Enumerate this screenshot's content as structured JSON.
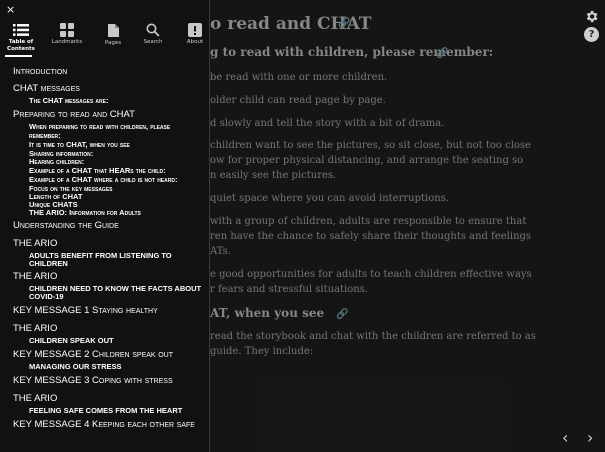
{
  "reader": {
    "heading_main": "o read and CHAT",
    "heading_sub": "g to read with children, please remember:",
    "paragraphs": [
      "be read with one or more children.",
      "older child can read page by page.",
      "d slowly and tell the story with a bit of drama.",
      "children want to see the pictures, so sit close, but not too close",
      "ow for proper physical distancing, and arrange the seating so",
      "n easily see the pictures.",
      "quiet space where you can avoid interruptions.",
      "with a group of children, adults are responsible to ensure that",
      "ren have the chance to safely share their thoughts and feelings",
      "ATs.",
      "e good opportunities for adults to teach children effective ways",
      "r fears and stressful situations."
    ],
    "heading_chat": "AT, when you see",
    "paragraphs2": [
      "read the storybook and chat with the children are referred to as",
      "guide. They include:"
    ],
    "help_label": "?"
  },
  "sidebar": {
    "close_label": "×",
    "tabs": [
      {
        "label": "Table of Contents",
        "icon": "list-icon"
      },
      {
        "label": "Landmarks",
        "icon": "grid-icon"
      },
      {
        "label": "Pages",
        "icon": "pages-icon"
      },
      {
        "label": "Search",
        "icon": "search-icon"
      },
      {
        "label": "About",
        "icon": "info-icon"
      }
    ],
    "toc": [
      {
        "label": "Introduction",
        "level": 1
      },
      {
        "label": "CHAT messages",
        "level": 1
      },
      {
        "label": "The CHAT messages are:",
        "level": 2
      },
      {
        "label": "Preparing to read and CHAT",
        "level": 1
      },
      {
        "label": "When preparing to read with children, please",
        "level": 2
      },
      {
        "label": "remember:",
        "level": 2
      },
      {
        "label": "It is time to CHAT, when you see",
        "level": 2
      },
      {
        "label": "Sharing information:",
        "level": 2
      },
      {
        "label": "Hearing children:",
        "level": 2
      },
      {
        "label": "Example of a CHAT that HEARs the child:",
        "level": 2
      },
      {
        "label": "Example of a CHAT where a child is not heard:",
        "level": 2
      },
      {
        "label": "Focus on the key messages",
        "level": 2
      },
      {
        "label": "Length of CHAT",
        "level": 2
      },
      {
        "label": "Unique CHATS",
        "level": 2
      },
      {
        "label": "THE ARIO: Information for Adults",
        "level": 2
      },
      {
        "label": "Understanding the Guide",
        "level": 1
      },
      {
        "label": "THE ARIO",
        "level": 1
      },
      {
        "label": "ADULTS BENEFIT FROM LISTENING TO",
        "level": 2
      },
      {
        "label": "CHILDREN",
        "level": 2
      },
      {
        "label": "THE ARIO",
        "level": 1
      },
      {
        "label": "CHILDREN NEED TO KNOW THE FACTS ABOUT",
        "level": 2
      },
      {
        "label": "COVID-19",
        "level": 2
      },
      {
        "label": "KEY MESSAGE 1 Staying healthy",
        "level": 1
      },
      {
        "label": "THE ARIO",
        "level": 1
      },
      {
        "label": "CHILDREN SPEAK OUT",
        "level": 2
      },
      {
        "label": "KEY MESSAGE 2 Children speak out",
        "level": 1
      },
      {
        "label": "MANAGING OUR STRESS",
        "level": 2
      },
      {
        "label": "KEY MESSAGE 3 Coping with stress",
        "level": 1
      },
      {
        "label": "THE ARIO",
        "level": 1
      },
      {
        "label": "FEELING SAFE COMES FROM THE HEART",
        "level": 2
      },
      {
        "label": "KEY MESSAGE 4 Keeping each other safe",
        "level": 1
      }
    ]
  },
  "nav": {
    "prev_label": "‹",
    "next_label": "›"
  }
}
